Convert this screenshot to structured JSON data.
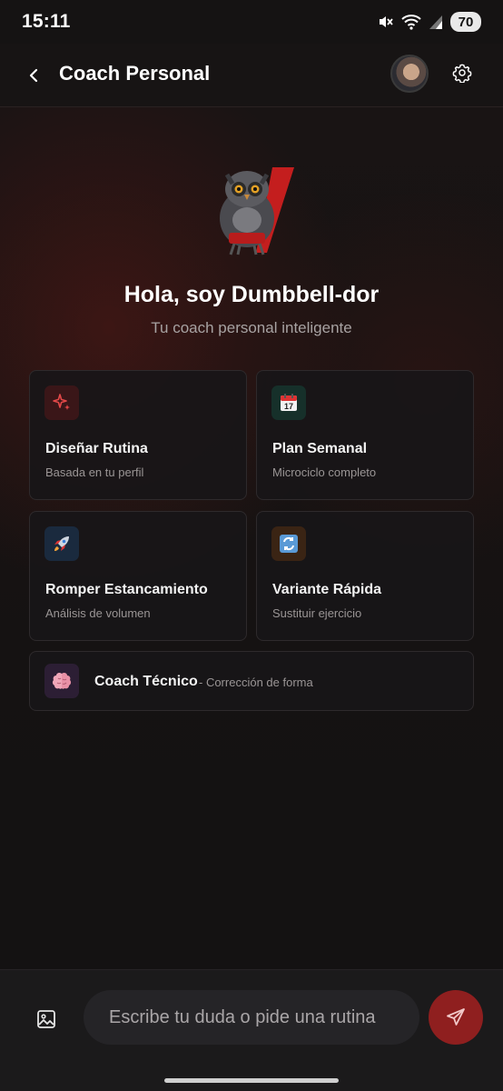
{
  "status_bar": {
    "time": "15:11",
    "battery": "70",
    "icons": [
      "mute-icon",
      "wifi-icon",
      "signal-icon"
    ]
  },
  "app_bar": {
    "title": "Coach Personal",
    "back_icon": "chevron-left-icon",
    "settings_icon": "gear-icon"
  },
  "hero": {
    "greeting": "Hola, soy Dumbbell-dor",
    "subtitle": "Tu coach personal inteligente"
  },
  "cards": [
    {
      "title": "Diseñar Rutina",
      "subtitle": "Basada en tu perfil",
      "icon": "sparkles-icon",
      "icon_bg": "#3a1618",
      "icon_color": "#e24848"
    },
    {
      "title": "Plan Semanal",
      "subtitle": "Microciclo completo",
      "icon": "calendar-icon",
      "icon_bg": "#16302a"
    },
    {
      "title": "Romper Estancamiento",
      "subtitle": "Análisis de volumen",
      "icon": "rocket-icon",
      "icon_bg": "#1a2a3e"
    },
    {
      "title": "Variante Rápida",
      "subtitle": "Sustituir ejercicio",
      "icon": "arrows-refresh-icon",
      "icon_bg": "#3a2414"
    },
    {
      "title": "Coach Técnico",
      "subtitle": "- Corrección de forma",
      "icon": "brain-icon",
      "icon_bg": "#2c1e34"
    }
  ],
  "composer": {
    "placeholder": "Escribe tu duda o pide una rutina",
    "send_color": "#8f1f1f"
  },
  "colors": {
    "accent": "#8f1f1f",
    "background": "#121212"
  }
}
